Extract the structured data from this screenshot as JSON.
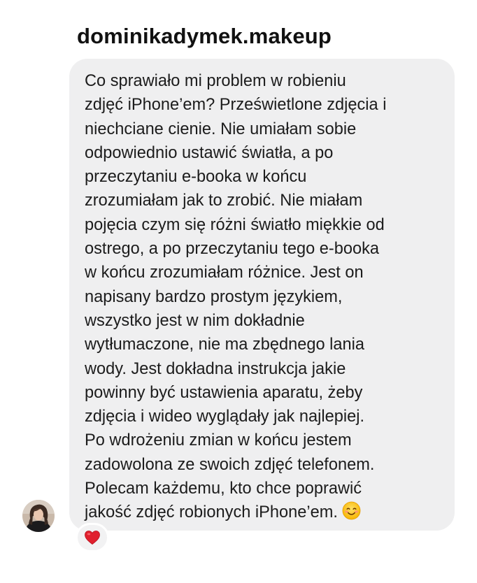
{
  "sender": {
    "username": "dominikadymek.makeup",
    "avatar_icon": "user-avatar-photo"
  },
  "message": {
    "lines": [
      "Co sprawiało mi problem w robieniu",
      "zdjęć iPhone’em? Prześwietlone zdjęcia i",
      "niechciane cienie. Nie umiałam sobie",
      "odpowiednio ustawić światła, a po",
      "przeczytaniu e-booka w końcu",
      "zrozumiałam jak to zrobić. Nie miałam",
      "pojęcia czym się różni światło miękkie od",
      "ostrego, a po przeczytaniu tego e-booka",
      "w końcu zrozumiałam różnice. Jest on",
      "napisany bardzo prostym językiem,",
      "wszystko jest w nim dokładnie",
      "wytłumaczone, nie ma zbędnego lania",
      "wody. Jest dokładna instrukcja jakie",
      "powinny być ustawienia aparatu, żeby",
      "zdjęcia i wideo wyglądały jak najlepiej.",
      "Po wdrożeniu zmian w końcu jestem",
      "zadowolona ze swoich zdjęć telefonem.",
      "Polecam każdemu, kto chce poprawić",
      "jakość zdjęć robionych iPhone’em."
    ],
    "end_emoji": "smiling-face-icon",
    "bubble_color": "#efeff0",
    "text_color": "#1c1c1c"
  },
  "reaction": {
    "icon": "red-heart-icon",
    "color": "#e0202e"
  }
}
